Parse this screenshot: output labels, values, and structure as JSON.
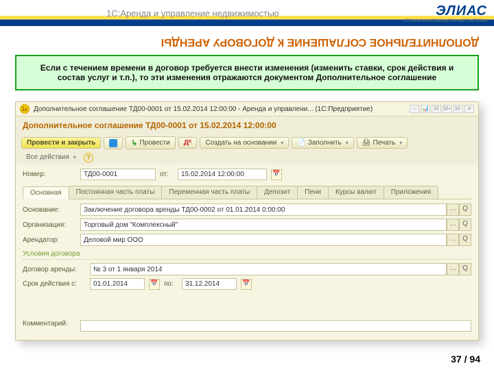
{
  "header": {
    "title": "1С:Аренда и управление недвижимостью",
    "logo_main": "ЭЛИАС",
    "logo_sub": "СТРОИМ ИНФОРМАЦИОННЫЕ СИСТЕМЫ"
  },
  "slide_title": "ДОПОЛНИТЕЛЬНОЕ СОГЛАШЕНИЕ К ДОГОВОРУ АРЕНДЫ",
  "intro": "Если с течением времени в договор требуется внести изменения (изменить ставки, срок действия и состав услуг и т.п.), то эти изменения отражаются документом Дополнительное соглашение",
  "window_title": "Дополнительное соглашение ТД00-0001 от 15.02.2014 12:00:00 - Аренда и управлени... (1С:Предприятие)",
  "doc_title": "Дополнительное соглашение ТД00-0001 от 15.02.2014 12:00:00",
  "toolbar": {
    "post_close": "Провести и закрыть",
    "post": "Провести",
    "create_based": "Создать на основании",
    "fill": "Заполнить",
    "print": "Печать",
    "all_actions": "Все действия"
  },
  "fields": {
    "number_lbl": "Номер:",
    "number": "ТД00-0001",
    "from_lbl": "от:",
    "date": "15.02.2014 12:00:00",
    "basis_lbl": "Основание:",
    "basis": "Заключение договора аренды ТД00-0002 от 01.01.2014 0:00:00",
    "org_lbl": "Организация:",
    "org": "Торговый дом \"Комплексный\"",
    "tenant_lbl": "Арендатор:",
    "tenant": "Деловой мир ООО",
    "contract_terms": "Условия договора",
    "contract_lbl": "Договор аренды:",
    "contract": "№ 3 от 1 января 2014",
    "validity_lbl": "Срок действия с:",
    "date_from": "01.01.2014",
    "to_lbl": "по:",
    "date_to": "31.12.2014",
    "comment_lbl": "Комментарий:"
  },
  "tabs": [
    "Основная",
    "Постоянная часть платы",
    "Переменная часть платы",
    "Депозит",
    "Пени",
    "Курсы валют",
    "Приложения"
  ],
  "page": "37 / 94"
}
